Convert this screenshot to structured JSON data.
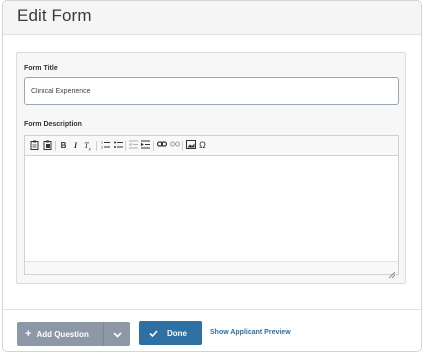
{
  "header": {
    "title": "Edit Form"
  },
  "form": {
    "title_label": "Form Title",
    "title_value": "Clinical Experience",
    "description_label": "Form Description"
  },
  "editor": {
    "toolbar_icons": [
      "paste-icon",
      "paste-text-icon",
      "bold-icon",
      "italic-icon",
      "remove-format-icon",
      "numbered-list-icon",
      "bulleted-list-icon",
      "outdent-icon",
      "indent-icon",
      "link-icon",
      "unlink-icon",
      "image-icon",
      "special-character-icon"
    ]
  },
  "footer": {
    "add_question_label": "Add Question",
    "done_label": "Done",
    "preview_label": "Show Applicant Preview"
  },
  "colors": {
    "primary": "#2e6fa4",
    "secondary_button": "#8d98a6",
    "header_bg": "#f5f5f5"
  }
}
